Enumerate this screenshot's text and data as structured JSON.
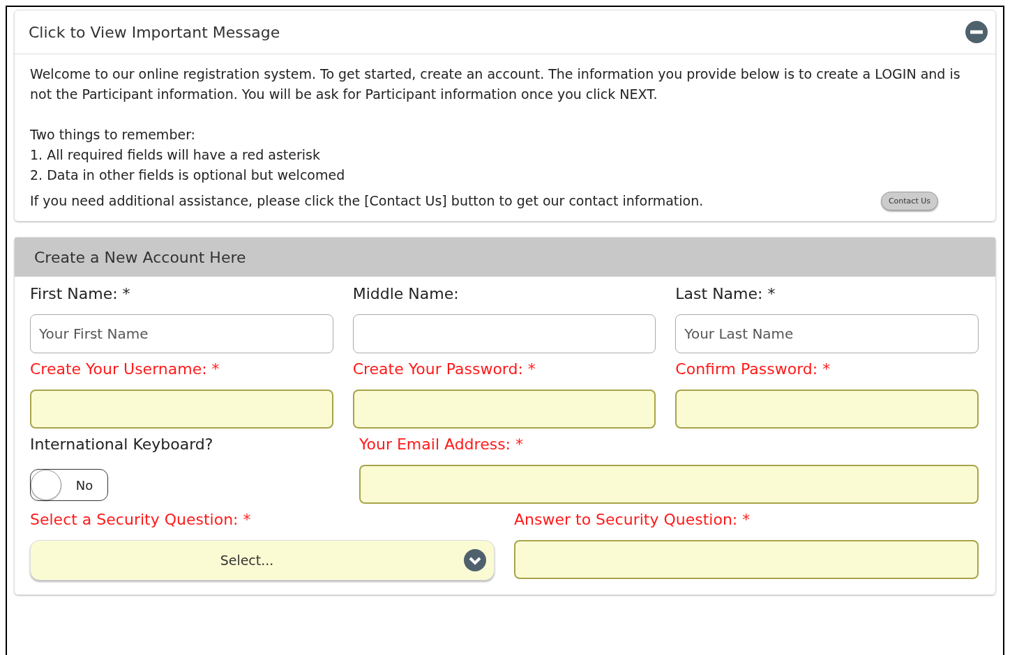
{
  "message_panel": {
    "title": "Click to View Important Message",
    "expanded": true,
    "intro": "Welcome to our online registration system. To get started, create an account. The information you provide below is to create a LOGIN and is not the Participant information. You will be ask for Participant information once you click NEXT.",
    "list_title": "Two things to remember:",
    "list_items": [
      "1. All required fields will have a red asterisk",
      "2. Data in other fields is optional but welcomed"
    ],
    "help_text": "If you need additional assistance, please click the [Contact Us] button to get our contact information.",
    "contact_button": "Contact Us"
  },
  "form": {
    "title": "Create a New Account Here",
    "rows": [
      [
        {
          "kind": "text",
          "label": "First Name: *",
          "highlighted": false,
          "placeholder": "Your First Name"
        },
        {
          "kind": "text",
          "label": "Middle Name:",
          "highlighted": false
        },
        {
          "kind": "text",
          "label": "Last Name: *",
          "highlighted": false,
          "placeholder": "Your Last Name"
        }
      ],
      [
        {
          "kind": "text",
          "label": "Create Your Username: *",
          "highlighted": true
        },
        {
          "kind": "text",
          "label": "Create Your Password: *",
          "highlighted": true
        },
        {
          "kind": "text",
          "label": "Confirm Password: *",
          "highlighted": true
        }
      ],
      [
        {
          "kind": "toggle",
          "label": "International Keyboard?",
          "highlighted": false,
          "on": false,
          "value": "No"
        },
        {
          "kind": "text",
          "label": "Your Email Address: *",
          "highlighted": true
        }
      ],
      [
        {
          "kind": "select",
          "label": "Select a Security Question: *",
          "highlighted": true,
          "value": "Select..."
        },
        {
          "kind": "text",
          "label": "Answer to Security Question: *",
          "highlighted": true
        }
      ]
    ]
  }
}
